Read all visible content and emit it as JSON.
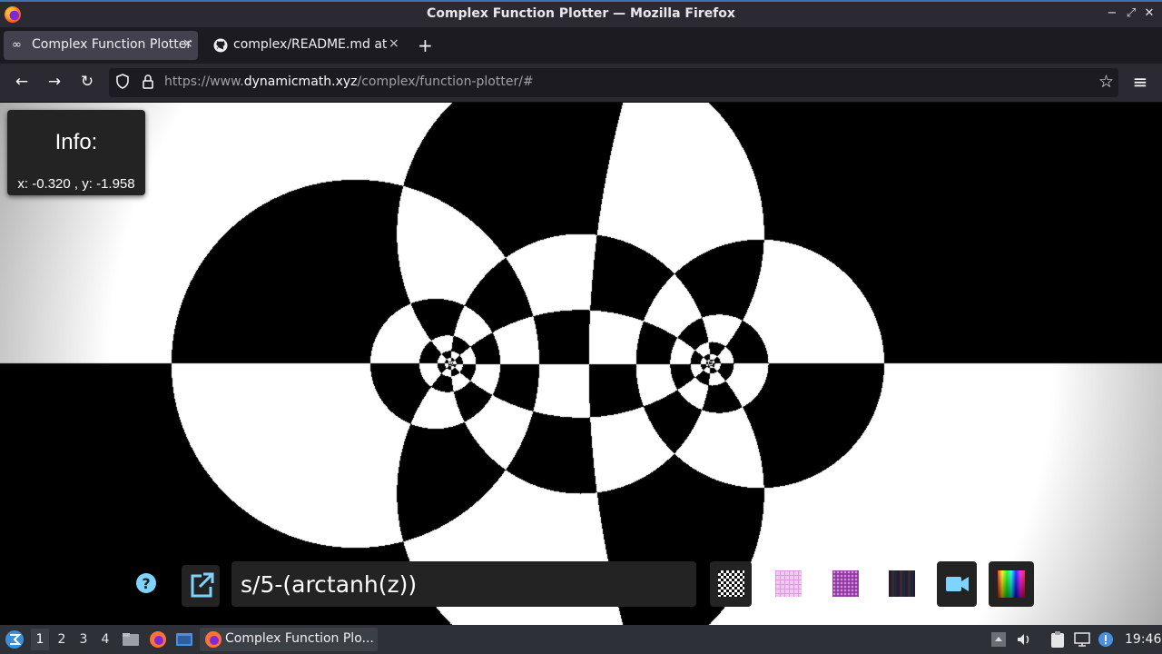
{
  "window": {
    "title": "Complex Function Plotter — Mozilla Firefox",
    "minimize_glyph": "−",
    "maximize_glyph": "⤢",
    "close_glyph": "✕"
  },
  "tabs": [
    {
      "label": "Complex Function Plotter",
      "icon": "infinity-icon",
      "icon_glyph": "∞",
      "close_glyph": "×",
      "active": true
    },
    {
      "label": "complex/README.md at",
      "icon": "github-icon",
      "close_glyph": "×",
      "active": false
    }
  ],
  "new_tab_glyph": "+",
  "navbar": {
    "back_glyph": "←",
    "forward_glyph": "→",
    "reload_glyph": "↻",
    "menu_glyph": "≡",
    "url_prefix": "https://www.",
    "url_domain": "dynamicmath.xyz",
    "url_path": "/complex/function-plotter/#",
    "star_glyph": "☆"
  },
  "info": {
    "heading": "Info:",
    "coords": "x: -0.320 , y: -1.958"
  },
  "controls": {
    "function_value": "s/5-(arctanh(z))",
    "texture_swatches": [
      {
        "name": "checker-texture-swatch",
        "selected": true
      },
      {
        "name": "pink-grid-texture-swatch",
        "selected": false
      },
      {
        "name": "purple-pattern-texture-swatch",
        "selected": false
      },
      {
        "name": "dark-stripes-texture-swatch",
        "selected": false
      }
    ],
    "colors": {
      "accent": "#7fd3ff",
      "panel": "#232323"
    }
  },
  "taskbar": {
    "workspaces": [
      "1",
      "2",
      "3",
      "4"
    ],
    "current_workspace": "1",
    "task_label": "Complex Function Plo...",
    "clock": "19:46"
  }
}
